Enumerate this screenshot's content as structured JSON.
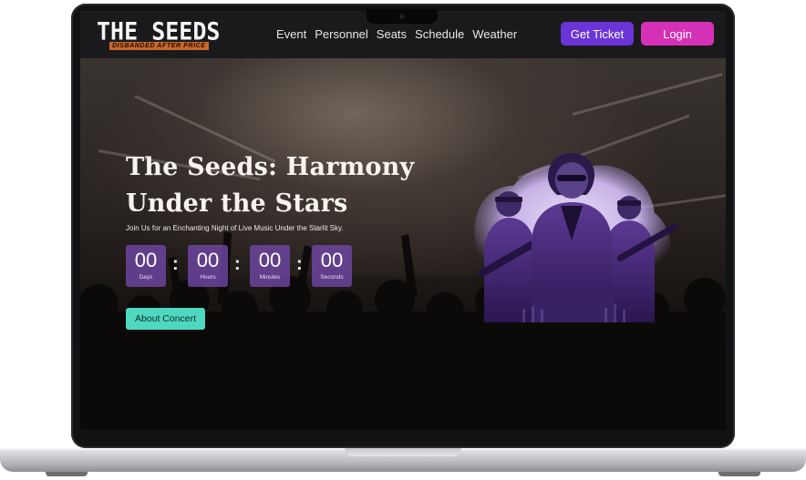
{
  "brand": {
    "name": "THE SEEDS",
    "tagline": "DISBANDED AFTER PRICE"
  },
  "nav": {
    "links": [
      "Event",
      "Personnel",
      "Seats",
      "Schedule",
      "Weather"
    ],
    "ticket_label": "Get Ticket",
    "login_label": "Login"
  },
  "hero": {
    "title_line1": "The Seeds: Harmony",
    "title_line2": "Under the Stars",
    "subtitle": "Join Us for an Enchanting Night of Live Music Under the Starlit Sky.",
    "countdown": [
      {
        "value": "00",
        "label": "Days"
      },
      {
        "value": "00",
        "label": "Hours"
      },
      {
        "value": "00",
        "label": "Minutes"
      },
      {
        "value": "00",
        "label": "Seconds"
      }
    ],
    "separator": ":",
    "about_label": "About Concert"
  },
  "colors": {
    "ticket_button": "#6b34d6",
    "login_button": "#d431b6",
    "about_button": "#4fd8c0",
    "countdown_box": "#7348aa",
    "navbar": "#1a1a1c"
  },
  "icons": {
    "band_illustration": "band-members-illustration"
  }
}
